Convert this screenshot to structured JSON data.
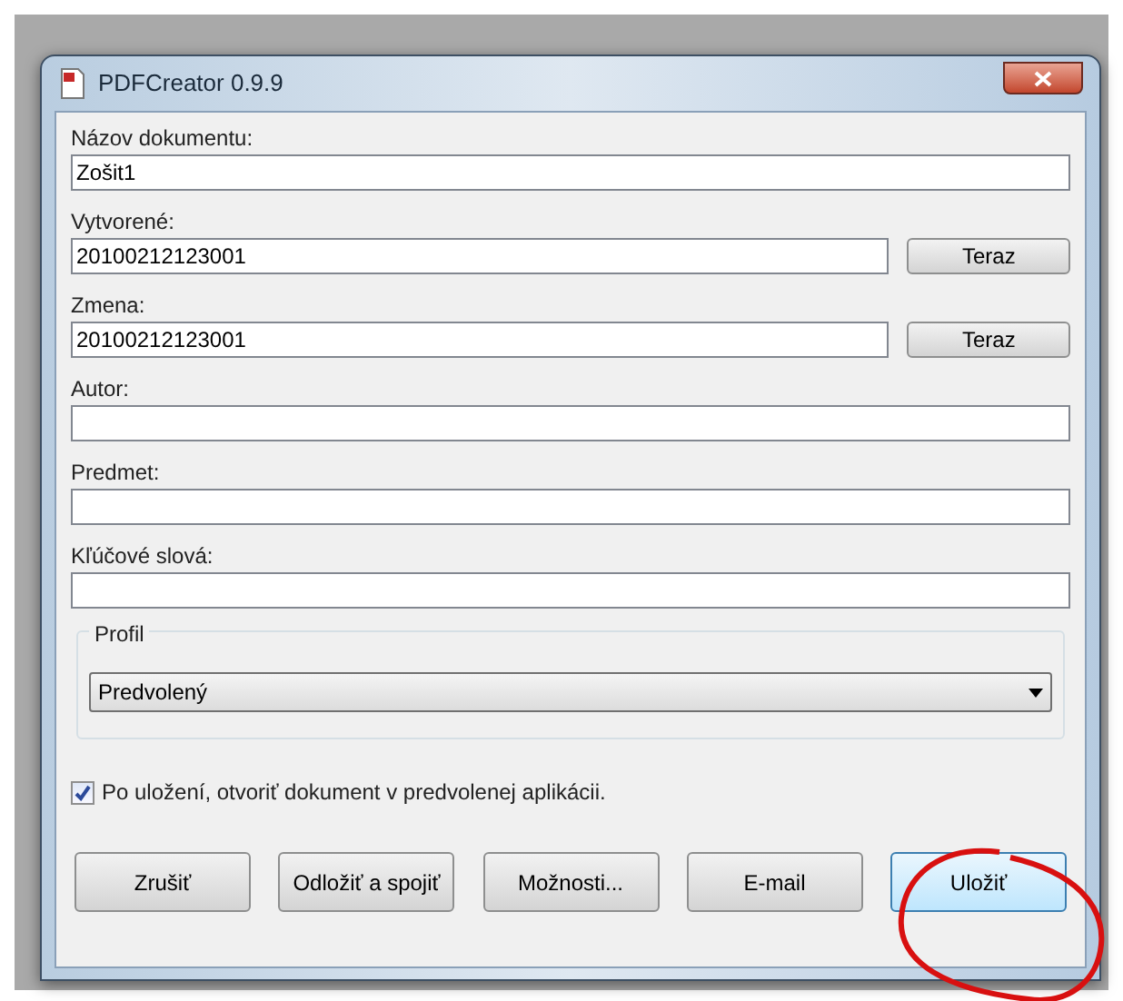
{
  "window": {
    "title": "PDFCreator 0.9.9"
  },
  "fields": [
    {
      "label": "Názov dokumentu:",
      "value": "Zošit1"
    },
    {
      "label": "Vytvorené:",
      "value": "20100212123001",
      "button": "Teraz"
    },
    {
      "label": "Zmena:",
      "value": "20100212123001",
      "button": "Teraz"
    },
    {
      "label": "Autor:"
    },
    {
      "label": "Predmet:"
    },
    {
      "label": "Kľúčové slová:"
    }
  ],
  "profile": {
    "title": "Profil",
    "value": "Predvolený"
  },
  "open_after_save": {
    "label": "Po uložení, otvoriť dokument v predvolenej aplikácii.",
    "checked": true
  },
  "buttons": [
    {
      "label": "Zrušiť",
      "default": false
    },
    {
      "label": "Odložiť a spojiť",
      "default": false
    },
    {
      "label": "Možnosti...",
      "default": false
    },
    {
      "label": "E-mail",
      "default": false
    },
    {
      "label": "Uložiť",
      "default": true
    }
  ]
}
